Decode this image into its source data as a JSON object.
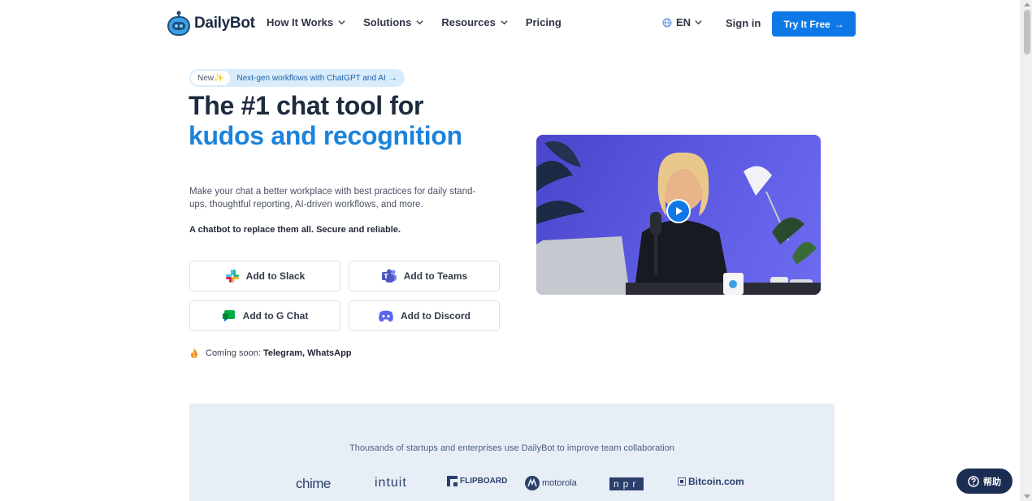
{
  "header": {
    "logo_text": "DailyBot",
    "nav": [
      {
        "label": "How It Works"
      },
      {
        "label": "Solutions"
      },
      {
        "label": "Resources"
      },
      {
        "label": "Pricing"
      }
    ],
    "language": "EN",
    "sign_in": "Sign in",
    "cta": "Try It Free",
    "cta_arrow": "→"
  },
  "hero": {
    "pill_badge": "New✨",
    "pill_text": "Next-gen workflows with ChatGPT and AI",
    "pill_arrow": "→",
    "title_line1": "The #1 chat tool for",
    "title_line2": "kudos and recognition",
    "lead": "Make your chat a better workplace with best practices for daily stand-ups, thoughtful reporting, AI-driven workflows, and more.",
    "tagline": "A chatbot to replace them all. Secure and reliable.",
    "buttons": [
      {
        "label": "Add to Slack",
        "icon": "slack-icon"
      },
      {
        "label": "Add to Teams",
        "icon": "teams-icon"
      },
      {
        "label": "Add to G Chat",
        "icon": "google-chat-icon"
      },
      {
        "label": "Add to Discord",
        "icon": "discord-icon"
      }
    ],
    "coming_soon_label": "Coming soon:",
    "coming_soon_items": "Telegram, WhatsApp"
  },
  "logos": {
    "caption": "Thousands of startups and enterprises use DailyBot to improve team collaboration",
    "brands": [
      "chime",
      "intuit",
      "FLIPBOARD",
      "motorola",
      "npr",
      "Bitcoin.com"
    ]
  },
  "help": {
    "label": "帮助"
  },
  "colors": {
    "primary": "#0e79e6",
    "title_accent": "#1b83dc",
    "navy": "#1b2d52",
    "band": "#e8eef6"
  }
}
